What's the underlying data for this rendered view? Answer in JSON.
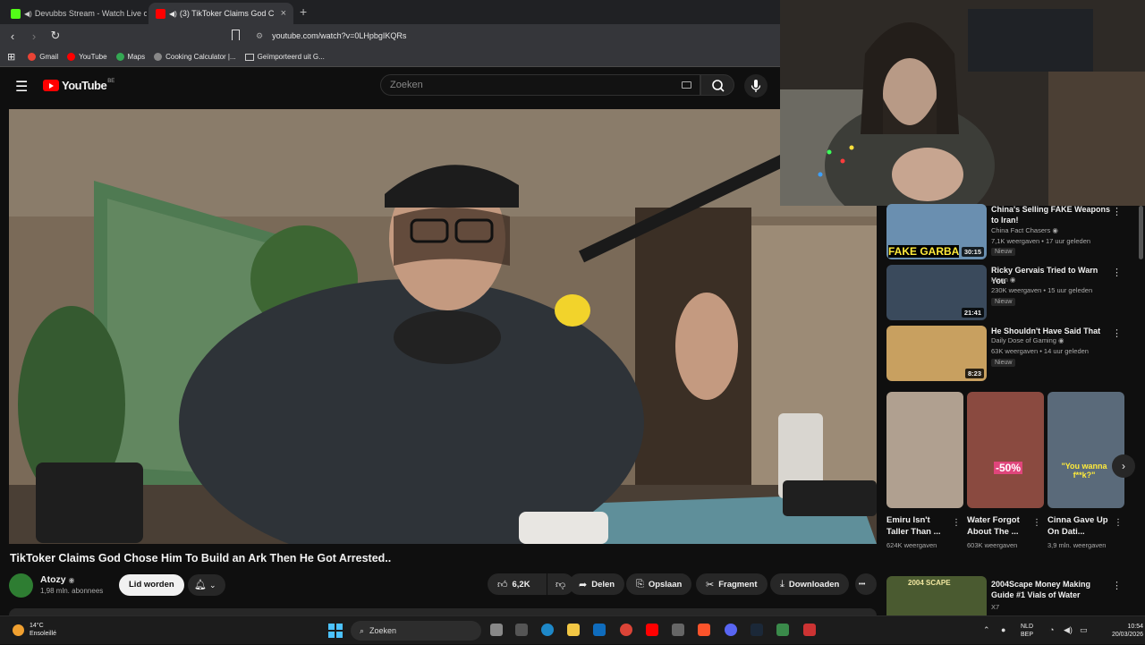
{
  "browser": {
    "tabs": [
      {
        "title": "Devubbs Stream - Watch Live on",
        "favicon_color": "#53fc18",
        "active": false
      },
      {
        "title": "(3) TikToker Claims God Chos",
        "favicon_color": "#ff0000",
        "active": true
      }
    ],
    "new_tab_symbol": "+",
    "close_symbol": "×",
    "url": "youtube.com/watch?v=0LHpbgIKQRs",
    "bookmarks": [
      {
        "label": "Gmail",
        "color": "#ea4335"
      },
      {
        "label": "YouTube",
        "color": "#ff0000"
      },
      {
        "label": "Maps",
        "color": "#34a853"
      },
      {
        "label": "Cooking Calculator |...",
        "color": "#888888"
      },
      {
        "label": "Geïmporteerd uit G...",
        "color": "#bbbbbb"
      }
    ]
  },
  "youtube": {
    "logo_text": "YouTube",
    "country_code": "BE",
    "search_placeholder": "Zoeken"
  },
  "video": {
    "title": "TikToker Claims God Chose Him To Build an Ark Then He Got Arrested..",
    "channel": "Atozy",
    "subscribers": "1,98 mln. abonnees",
    "join_label": "Lid worden",
    "likes": "6,2K",
    "share_label": "Delen",
    "save_label": "Opslaan",
    "clip_label": "Fragment",
    "download_label": "Downloaden",
    "more_symbol": "•••"
  },
  "recommendations": [
    {
      "title": "China's Selling FAKE Weapons to Iran!",
      "channel": "China Fact Chasers",
      "verified": true,
      "meta": "7,1K weergaven • 17 uur geleden",
      "badge": "Nieuw",
      "duration": "30:15",
      "thumb_text": "FAKE GARBA",
      "thumb_color": "#6a8fb0"
    },
    {
      "title": "Ricky Gervais Tried to Warn You",
      "channel": "Moon",
      "verified": true,
      "meta": "230K weergaven • 15 uur geleden",
      "badge": "Nieuw",
      "duration": "21:41",
      "thumb_text": "",
      "thumb_color": "#3a4a5c"
    },
    {
      "title": "He Shouldn't Have Said That",
      "channel": "Daily Dose of Gaming",
      "verified": true,
      "meta": "63K weergaven • 14 uur geleden",
      "badge": "Nieuw",
      "duration": "8:23",
      "thumb_text": "",
      "thumb_color": "#c8a060"
    }
  ],
  "shorts": [
    {
      "title": "Emiru Isn't Taller Than ...",
      "views": "624K weergaven",
      "overlay": "",
      "color": "#b0a090"
    },
    {
      "title": "Water Forgot About The ...",
      "views": "603K weergaven",
      "overlay": "-50%",
      "color": "#8a4a40"
    },
    {
      "title": "Cinna Gave Up On Dati...",
      "views": "3,9 mln. weergaven",
      "overlay": "\"You wanna f**k?\"",
      "color": "#5a6a7a"
    }
  ],
  "next_rec": {
    "title": "2004Scape Money Making Guide #1 Vials of Water",
    "channel": "X7",
    "thumb_text": "2004 SCAPE",
    "thumb_color": "#4a5a30"
  },
  "taskbar": {
    "temperature": "14°C",
    "weather": "Ensoleillé",
    "search_label": "Zoeken",
    "lang_1": "NLD",
    "lang_2": "BEP",
    "time": "10:54",
    "date": "20/03/2026"
  }
}
